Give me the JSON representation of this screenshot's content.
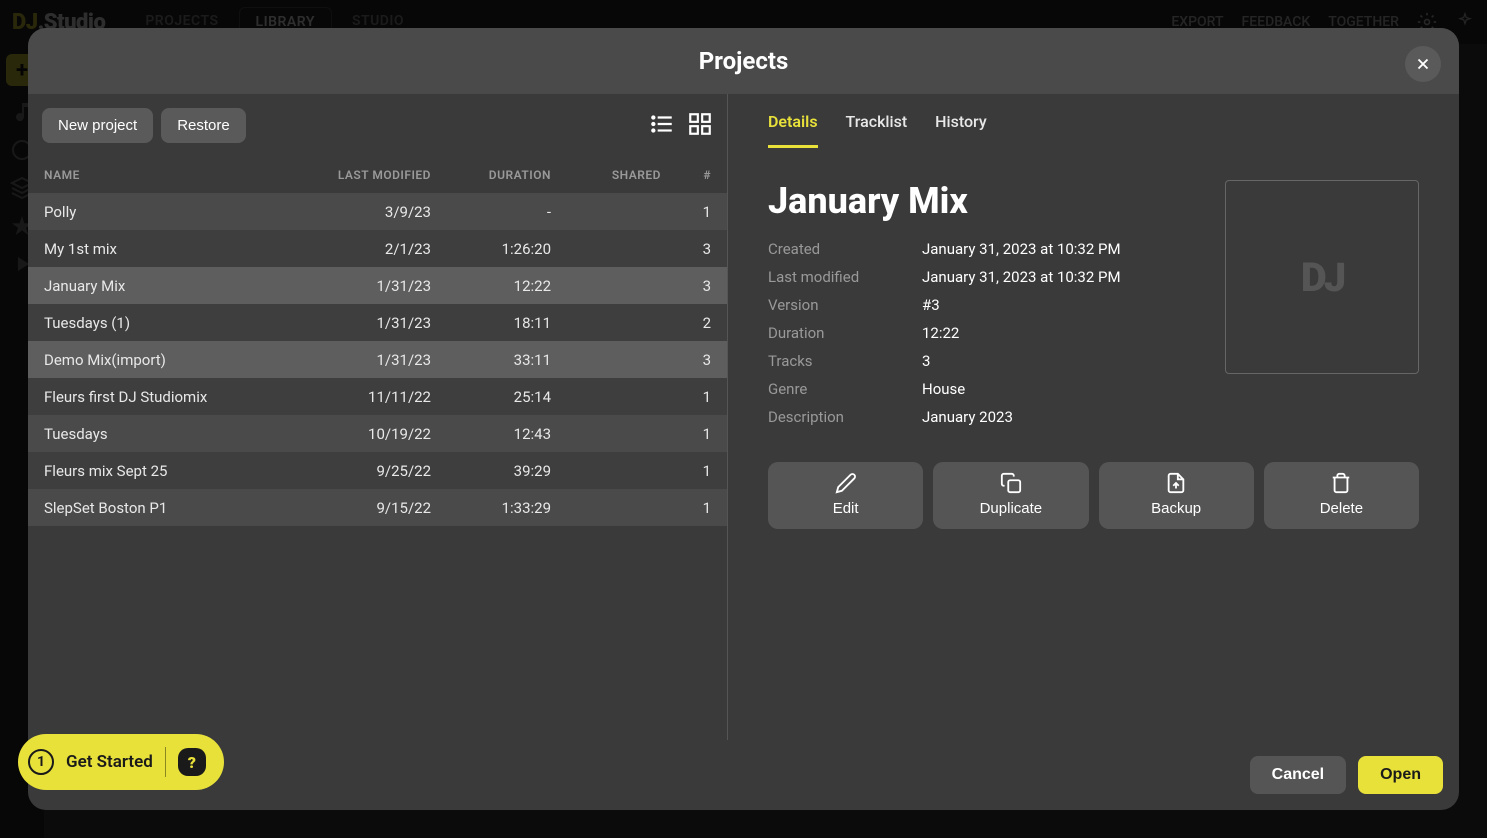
{
  "app": {
    "logo_prefix": "DJ",
    "logo_suffix": ".Studio",
    "nav": [
      "PROJECTS",
      "LIBRARY",
      "STUDIO"
    ],
    "nav_active": 1,
    "top_right": [
      "EXPORT",
      "FEEDBACK",
      "TOGETHER"
    ]
  },
  "modal": {
    "title": "Projects",
    "buttons": {
      "new_project": "New project",
      "restore": "Restore"
    },
    "columns": {
      "name": "NAME",
      "last_modified": "LAST MODIFIED",
      "duration": "DURATION",
      "shared": "SHARED",
      "count": "#"
    },
    "rows": [
      {
        "name": "Polly",
        "last_modified": "3/9/23",
        "duration": "-",
        "shared": "",
        "count": "1"
      },
      {
        "name": "My 1st mix",
        "last_modified": "2/1/23",
        "duration": "1:26:20",
        "shared": "",
        "count": "3"
      },
      {
        "name": "January Mix",
        "last_modified": "1/31/23",
        "duration": "12:22",
        "shared": "",
        "count": "3",
        "selected": true
      },
      {
        "name": "Tuesdays (1)",
        "last_modified": "1/31/23",
        "duration": "18:11",
        "shared": "",
        "count": "2"
      },
      {
        "name": "Demo Mix(import)",
        "last_modified": "1/31/23",
        "duration": "33:11",
        "shared": "",
        "count": "3",
        "highlight": true
      },
      {
        "name": "Fleurs first DJ Studiomix",
        "last_modified": "11/11/22",
        "duration": "25:14",
        "shared": "",
        "count": "1"
      },
      {
        "name": "Tuesdays",
        "last_modified": "10/19/22",
        "duration": "12:43",
        "shared": "",
        "count": "1"
      },
      {
        "name": "Fleurs mix Sept 25",
        "last_modified": "9/25/22",
        "duration": "39:29",
        "shared": "",
        "count": "1"
      },
      {
        "name": "SlepSet Boston P1",
        "last_modified": "9/15/22",
        "duration": "1:33:29",
        "shared": "",
        "count": "1"
      }
    ],
    "tabs": [
      "Details",
      "Tracklist",
      "History"
    ],
    "active_tab": 0,
    "details": {
      "title": "January Mix",
      "meta": {
        "created_label": "Created",
        "created_value": "January 31, 2023 at 10:32 PM",
        "modified_label": "Last modified",
        "modified_value": "January 31, 2023 at 10:32 PM",
        "version_label": "Version",
        "version_value": "#3",
        "duration_label": "Duration",
        "duration_value": "12:22",
        "tracks_label": "Tracks",
        "tracks_value": "3",
        "genre_label": "Genre",
        "genre_value": "House",
        "description_label": "Description",
        "description_value": "January 2023"
      },
      "actions": {
        "edit": "Edit",
        "duplicate": "Duplicate",
        "backup": "Backup",
        "delete": "Delete"
      }
    },
    "footer": {
      "cancel": "Cancel",
      "open": "Open"
    }
  },
  "get_started": {
    "step": "1",
    "label": "Get Started",
    "help": "?"
  }
}
